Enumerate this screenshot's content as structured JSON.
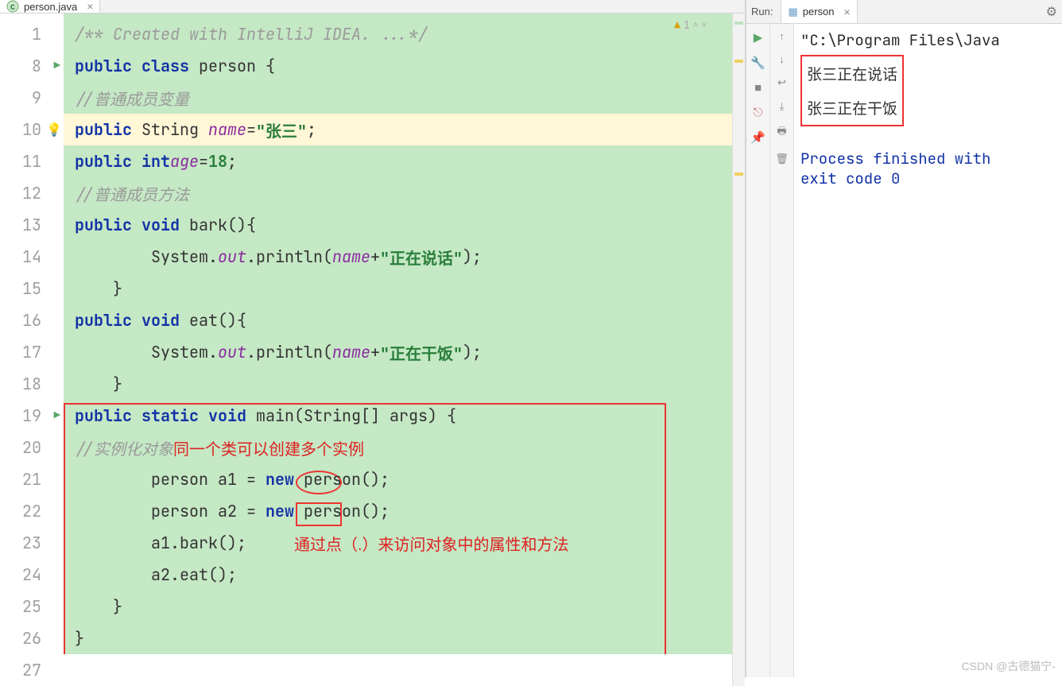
{
  "tab": {
    "filename": "person.java"
  },
  "code": {
    "lines": [
      {
        "n": "1",
        "html": "<span class='doc'>/** Created with IntelliJ IDEA. ...*/</span>"
      },
      {
        "n": "8",
        "html": "<span class='kw'>public class</span> person {",
        "run": true
      },
      {
        "n": "9",
        "html": "    <span class='cmt'>//普通成员变量</span>"
      },
      {
        "n": "10",
        "html": "    <span class='kw'>public</span> String <span class='field'>name</span>=<span class='str'>\"张三\"</span>;",
        "hl": true,
        "bulb": true
      },
      {
        "n": "11",
        "html": "    <span class='kw'>public int</span> <span class='field'>age</span>=<span class='str'>18</span>;"
      },
      {
        "n": "12",
        "html": "    <span class='cmt'>//普通成员方法</span>"
      },
      {
        "n": "13",
        "html": "    <span class='kw'>public void</span> bark(){"
      },
      {
        "n": "14",
        "html": "        System.<span class='field'>out</span>.println(<span class='field'>name</span>+<span class='str'>\"正在说话\"</span>);"
      },
      {
        "n": "15",
        "html": "    }"
      },
      {
        "n": "16",
        "html": "    <span class='kw'>public void</span> eat(){"
      },
      {
        "n": "17",
        "html": "        System.<span class='field'>out</span>.println(<span class='field'>name</span>+<span class='str'>\"正在干饭\"</span>);"
      },
      {
        "n": "18",
        "html": "    }"
      },
      {
        "n": "19",
        "html": "    <span class='kw'>public static void</span> main(String[] args) {",
        "run": true
      },
      {
        "n": "20",
        "html": "        <span class='cmt'>//实例化对象</span>      <span class='red-text'>同一个类可以创建多个实例</span>"
      },
      {
        "n": "21",
        "html": "        person a1 = <span class='kw'>new</span> person();"
      },
      {
        "n": "22",
        "html": "        person a2 = <span class='kw'>new</span> person();"
      },
      {
        "n": "23",
        "html": "        a1.bark();     <span class='red-text'>通过点（.）来访问对象中的属性和方法</span>"
      },
      {
        "n": "24",
        "html": "        a2.eat();"
      },
      {
        "n": "25",
        "html": "    }"
      },
      {
        "n": "26",
        "html": "}"
      },
      {
        "n": "27",
        "html": "",
        "plain": true
      }
    ],
    "warn_count": "1"
  },
  "run": {
    "label": "Run:",
    "tab_name": "person",
    "path": "\"C:\\Program Files\\Java",
    "out1": "张三正在说话",
    "out2": "张三正在干饭",
    "proc1": "Process finished with",
    "proc2": " exit code 0"
  },
  "watermark": "CSDN @古德猫宁-"
}
